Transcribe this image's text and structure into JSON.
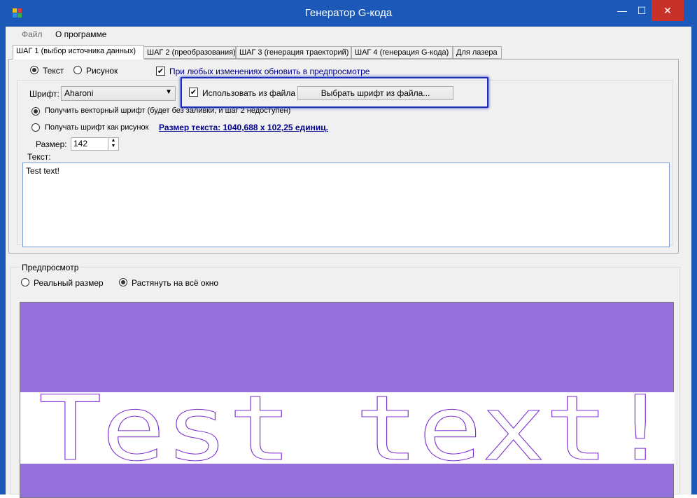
{
  "window": {
    "title": "Генератор G-кода",
    "minimize_symbol": "—",
    "maximize_symbol": "☐",
    "close_symbol": "✕"
  },
  "menu": {
    "file": "Файл",
    "about": "О программе"
  },
  "tabs": [
    {
      "label": "ШАГ 1 (выбор источника данных)"
    },
    {
      "label": "ШАГ 2 (преобразования)"
    },
    {
      "label": "ШАГ 3 (генерация траекторий)"
    },
    {
      "label": "ШАГ 4 (генерация G-кода)"
    },
    {
      "label": "Для лазера"
    }
  ],
  "step1": {
    "source_text": "Текст",
    "source_image": "Рисунок",
    "auto_update_label": "При любых изменениях обновить в предпросмотре",
    "font_label": "Шрифт:",
    "font_value": "Aharoni",
    "use_file_label": "Использовать из файла",
    "choose_font_button": "Выбрать шрифт из файла...",
    "vector_font_label": "Получить векторный шрифт (будет без заливки, и шаг 2 недоступен)",
    "raster_font_label": "Получать шрифт как рисунок",
    "text_size_link": "Размер текста: 1040,688 х 102,25 единиц.",
    "size_label": "Размер:",
    "size_value": "142",
    "text_label": "Текст:",
    "text_value": "Test text!"
  },
  "preview": {
    "group_label": "Предпросмотр",
    "real_size": "Реальный размер",
    "stretch": "Растянуть на всё окно",
    "rendered_text": "Test text!"
  },
  "colors": {
    "titlebar": "#1b58b8",
    "close": "#c7312a",
    "preview_bg": "#9370db",
    "glyph_stroke": "#7b2fd0",
    "link": "#00008b"
  }
}
